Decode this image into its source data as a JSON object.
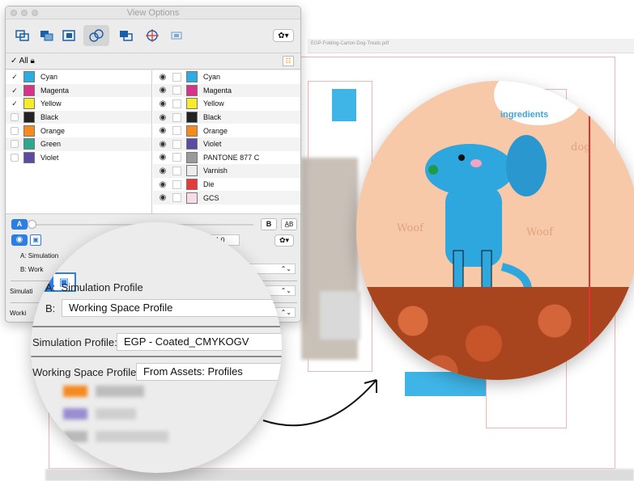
{
  "window": {
    "title": "View Options",
    "all_label": "All",
    "gear_label": "✿▾"
  },
  "toolbar": {
    "icons": [
      "separations-icon",
      "overprint-icon",
      "layers-icon",
      "inks-icon",
      "objects-icon",
      "crosshair-icon",
      "trim-icon"
    ]
  },
  "left_inks": [
    {
      "name": "Cyan",
      "color": "#29aee3",
      "checked": true
    },
    {
      "name": "Magenta",
      "color": "#d6338a",
      "checked": true
    },
    {
      "name": "Yellow",
      "color": "#f6ec2a",
      "checked": true
    },
    {
      "name": "Black",
      "color": "#222222",
      "checked": false
    },
    {
      "name": "Orange",
      "color": "#f58a1f",
      "checked": false
    },
    {
      "name": "Green",
      "color": "#2aa890",
      "checked": false
    },
    {
      "name": "Violet",
      "color": "#5d4aa3",
      "checked": false
    }
  ],
  "right_inks": [
    {
      "name": "Cyan",
      "color": "#29aee3"
    },
    {
      "name": "Magenta",
      "color": "#d6338a"
    },
    {
      "name": "Yellow",
      "color": "#f6ec2a"
    },
    {
      "name": "Black",
      "color": "#222222"
    },
    {
      "name": "Orange",
      "color": "#f58a1f"
    },
    {
      "name": "Violet",
      "color": "#5d4aa3"
    },
    {
      "name": "PANTONE 877 C",
      "color": "#9a9a9a"
    },
    {
      "name": "Varnish",
      "color": "#ececec"
    },
    {
      "name": "Die",
      "color": "#e43a3a"
    },
    {
      "name": "GCS",
      "color": "#f7dbe6"
    }
  ],
  "compare": {
    "a_label": "A",
    "b_label": "B",
    "ab_label": "A̲B",
    "delta_label": "ΔE: 4,0"
  },
  "small": {
    "a_prefix": "A:",
    "a_text": "Simulation",
    "b_prefix": "B:",
    "b_text": "Work",
    "simulation_prefix": "Simulati",
    "working_prefix": "Worki"
  },
  "zoom": {
    "a_prefix": "A:",
    "a_text": "Simulation Profile",
    "b_prefix": "B:",
    "b_value": "Working Space Profile",
    "simulation_label": "Simulation Profile:",
    "simulation_value": "EGP - Coated_CMYKOGV",
    "working_label": "Working Space Profile:",
    "working_value": "From Assets: Profiles"
  },
  "artwork": {
    "bubble_text": "ingredients",
    "words": [
      "Woof",
      "Woof",
      "dog"
    ]
  },
  "background": {
    "doc_title": "EGP-Folding-Carton-Dog-Treats.pdf"
  }
}
